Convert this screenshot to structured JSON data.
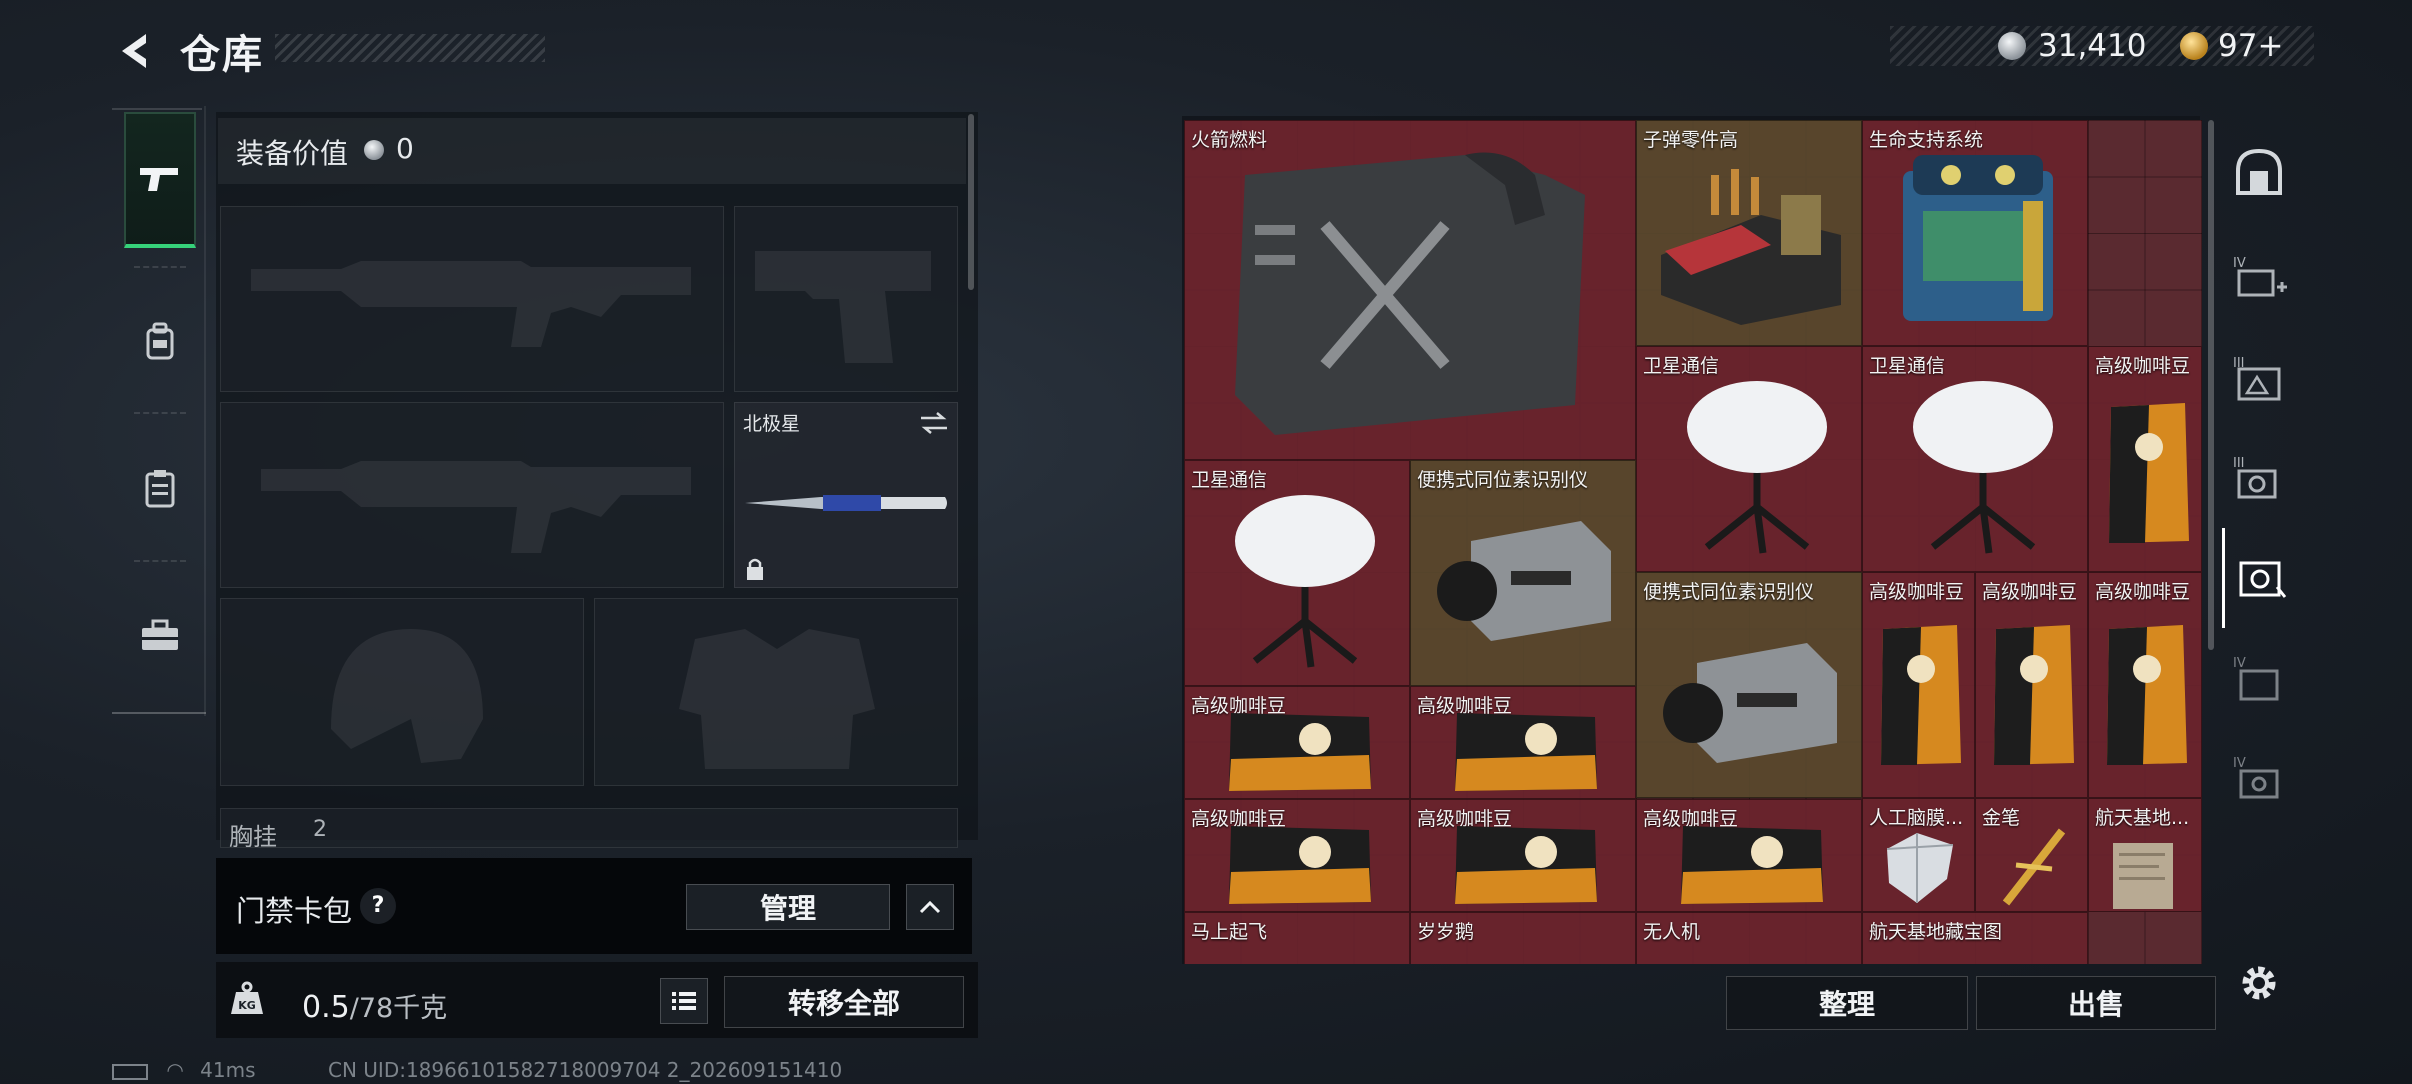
{
  "header": {
    "title": "仓库",
    "currency": [
      {
        "icon": "silver-coin-icon",
        "value": "31,410"
      },
      {
        "icon": "gold-coin-icon",
        "value": "97+"
      }
    ]
  },
  "sidebar": {
    "tabs": [
      {
        "icon": "pistol-icon",
        "active": true
      },
      {
        "icon": "backpack-icon",
        "active": false
      },
      {
        "icon": "clipboard-icon",
        "active": false
      },
      {
        "icon": "toolbox-icon",
        "active": false
      }
    ]
  },
  "loadout": {
    "value_label": "装备价值",
    "value": "0",
    "slots": [
      {
        "slot": "primary-rifle-1",
        "label": ""
      },
      {
        "slot": "sidearm-pistol",
        "label": ""
      },
      {
        "slot": "primary-rifle-2",
        "label": ""
      },
      {
        "slot": "melee",
        "label": "北极星"
      },
      {
        "slot": "helmet",
        "label": ""
      },
      {
        "slot": "armor",
        "label": ""
      },
      {
        "slot": "chest-rig",
        "label": "胸挂",
        "count": "2"
      }
    ]
  },
  "keycard": {
    "label": "门禁卡包",
    "help": "?",
    "manage_label": "管理"
  },
  "capacity": {
    "current": "0.5",
    "max": "/78千克",
    "transfer_all_label": "转移全部"
  },
  "stash": {
    "items": [
      {
        "name": "火箭燃料",
        "rarity": "red",
        "icon": "fuel-canister-icon"
      },
      {
        "name": "子弹零件高",
        "rarity": "gold",
        "icon": "ammo-parts-icon"
      },
      {
        "name": "生命支持系统",
        "rarity": "red",
        "icon": "life-support-icon"
      },
      {
        "name": "卫星通信",
        "rarity": "red",
        "icon": "satellite-dish-icon"
      },
      {
        "name": "卫星通信",
        "rarity": "red",
        "icon": "satellite-dish-icon"
      },
      {
        "name": "高级咖啡豆",
        "rarity": "red",
        "icon": "coffee-bag-icon"
      },
      {
        "name": "卫星通信",
        "rarity": "red",
        "icon": "satellite-dish-icon"
      },
      {
        "name": "便携式同位素识别仪",
        "rarity": "gold",
        "icon": "isotope-scanner-icon"
      },
      {
        "name": "便携式同位素识别仪",
        "rarity": "gold",
        "icon": "isotope-scanner-icon"
      },
      {
        "name": "高级咖啡豆",
        "rarity": "red",
        "icon": "coffee-bag-icon"
      },
      {
        "name": "高级咖啡豆",
        "rarity": "red",
        "icon": "coffee-bag-icon"
      },
      {
        "name": "高级咖啡豆",
        "rarity": "red",
        "icon": "coffee-bag-icon"
      },
      {
        "name": "高级咖啡豆",
        "rarity": "red",
        "icon": "coffee-bag-icon"
      },
      {
        "name": "高级咖啡豆",
        "rarity": "red",
        "icon": "coffee-bag-icon"
      },
      {
        "name": "高级咖啡豆",
        "rarity": "red",
        "icon": "coffee-bag-icon"
      },
      {
        "name": "高级咖啡豆",
        "rarity": "red",
        "icon": "coffee-bag-icon"
      },
      {
        "name": "高级咖啡豆",
        "rarity": "red",
        "icon": "coffee-bag-icon"
      },
      {
        "name": "人工脑膜...",
        "rarity": "red",
        "icon": "diamond-icon"
      },
      {
        "name": "金笔",
        "rarity": "red",
        "icon": "gold-pen-icon"
      },
      {
        "name": "航天基地...",
        "rarity": "red",
        "icon": "document-icon"
      },
      {
        "name": "马上起飞",
        "rarity": "red",
        "icon": "figurine-icon"
      },
      {
        "name": "岁岁鹅",
        "rarity": "red",
        "icon": "goose-icon"
      },
      {
        "name": "无人机",
        "rarity": "red",
        "icon": "drone-icon"
      },
      {
        "name": "航天基地藏宝图",
        "rarity": "red",
        "icon": "map-icon"
      }
    ],
    "sort_label": "整理",
    "sell_label": "出售"
  },
  "right_rail": {
    "tabs": [
      {
        "icon": "vault-icon",
        "active": false
      },
      {
        "icon": "medkit-add-icon",
        "badge": "IV",
        "active": false
      },
      {
        "icon": "map-case-icon",
        "badge": "III",
        "active": false
      },
      {
        "icon": "camera-case-icon",
        "badge": "III",
        "active": false
      },
      {
        "icon": "lens-case-icon",
        "badge": "",
        "active": true
      },
      {
        "icon": "folder-case-icon",
        "badge": "IV",
        "active": false
      },
      {
        "icon": "crate-icon",
        "badge": "IV",
        "active": false
      }
    ]
  },
  "status_bar": {
    "ping": "41ms",
    "uid": "CN UID:18966101582718009704 2_202609151410"
  },
  "colors": {
    "accent_green": "#36d27a",
    "rarity_red": "#69232d",
    "rarity_gold": "#58482c"
  }
}
